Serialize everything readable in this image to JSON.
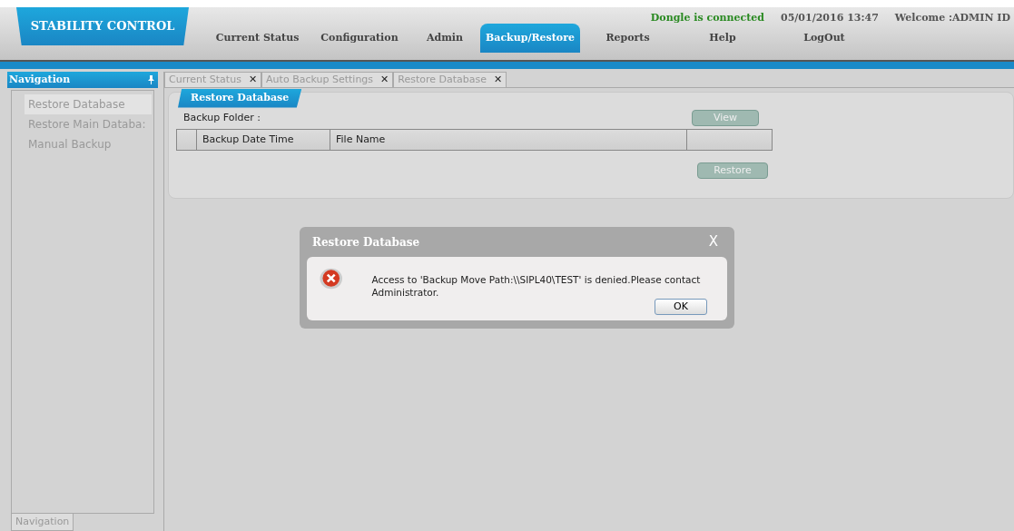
{
  "app_title": "STABILITY CONTROL",
  "status": {
    "dongle": "Dongle is connected",
    "datetime": "05/01/2016 13:47",
    "welcome": "Welcome :ADMIN ID"
  },
  "menu": [
    {
      "label": "Current Status",
      "selected": false
    },
    {
      "label": "Configuration",
      "selected": false
    },
    {
      "label": "Admin",
      "selected": false
    },
    {
      "label": "Backup/Restore",
      "selected": true
    },
    {
      "label": "Reports",
      "selected": false
    },
    {
      "label": "Help",
      "selected": false
    },
    {
      "label": "LogOut",
      "selected": false
    }
  ],
  "navigation": {
    "title": "Navigation",
    "items": [
      {
        "label": "Restore Database",
        "selected": true
      },
      {
        "label": "Restore Main Databa:",
        "selected": false
      },
      {
        "label": "Manual Backup",
        "selected": false
      }
    ],
    "bottom_tab": "Navigation"
  },
  "doc_tabs": [
    {
      "label": "Current Status",
      "close": "✕"
    },
    {
      "label": "Auto Backup Settings",
      "close": "✕"
    },
    {
      "label": "Restore Database",
      "close": "✕"
    }
  ],
  "panel": {
    "title": "Restore Database",
    "folder_label": "Backup Folder :",
    "view_button": "View",
    "columns": [
      "Backup Date Time",
      "File Name"
    ],
    "restore_button": "Restore"
  },
  "dialog": {
    "title": "Restore Database",
    "close": "X",
    "message": "Access to 'Backup Move Path:\\\\SIPL40\\TEST' is denied.Please contact Administrator.",
    "ok": "OK"
  }
}
